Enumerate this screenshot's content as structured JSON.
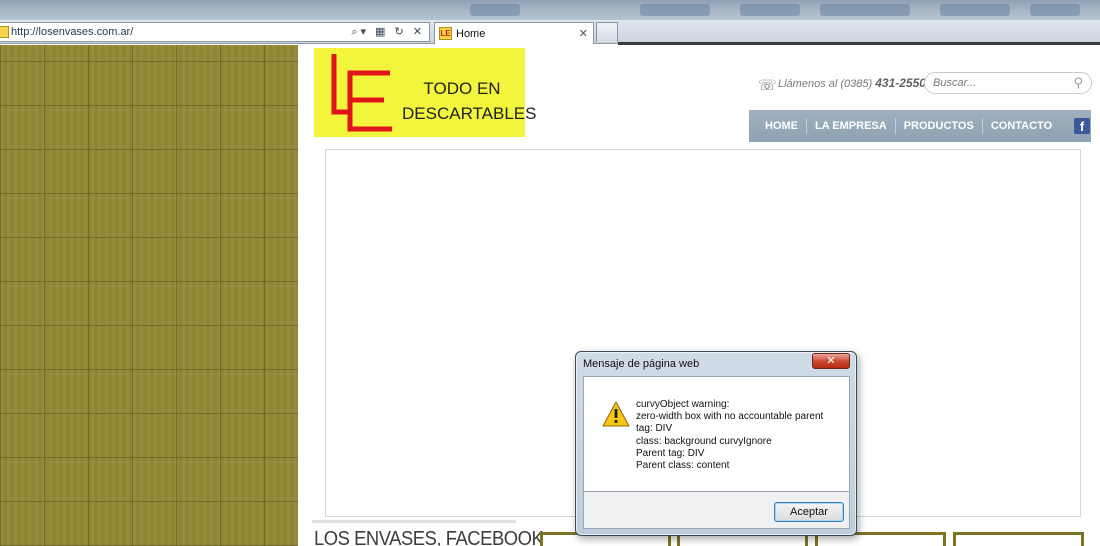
{
  "browser": {
    "address_url": "http://losenvases.com.ar/",
    "address_icons": "⌕▾ ▦ ↻ ✕",
    "tab_title": "Home",
    "tab_favicon_text": "LE",
    "tab_close": "✕"
  },
  "site": {
    "logo_text_line1": "TODO EN",
    "logo_text_line2": "DESCARTABLES",
    "phone_prefix": "Llámenos al (0385) ",
    "phone_number": "431-2550",
    "search_placeholder": "Buscar...",
    "nav": [
      "HOME",
      "LA EMPRESA",
      "PRODUCTOS",
      "CONTACTO"
    ],
    "facebook_icon_text": "f",
    "section_title": "LOS ENVASES, FACEBOOK",
    "colors": {
      "logo_bg": "#f2f53b",
      "logo_letters": "#e0141b",
      "nav_bg": "#9aacba",
      "wood": "#8f8534"
    }
  },
  "dialog": {
    "title": "Mensaje de página web",
    "close_label": "✕",
    "message_lines": [
      "curvyObject warning:",
      "zero-width box with no accountable parent",
      "tag: DIV",
      "class: background curvyIgnore",
      "Parent tag: DIV",
      "Parent class: content"
    ],
    "ok_label": "Aceptar",
    "icon": "warning-icon"
  }
}
